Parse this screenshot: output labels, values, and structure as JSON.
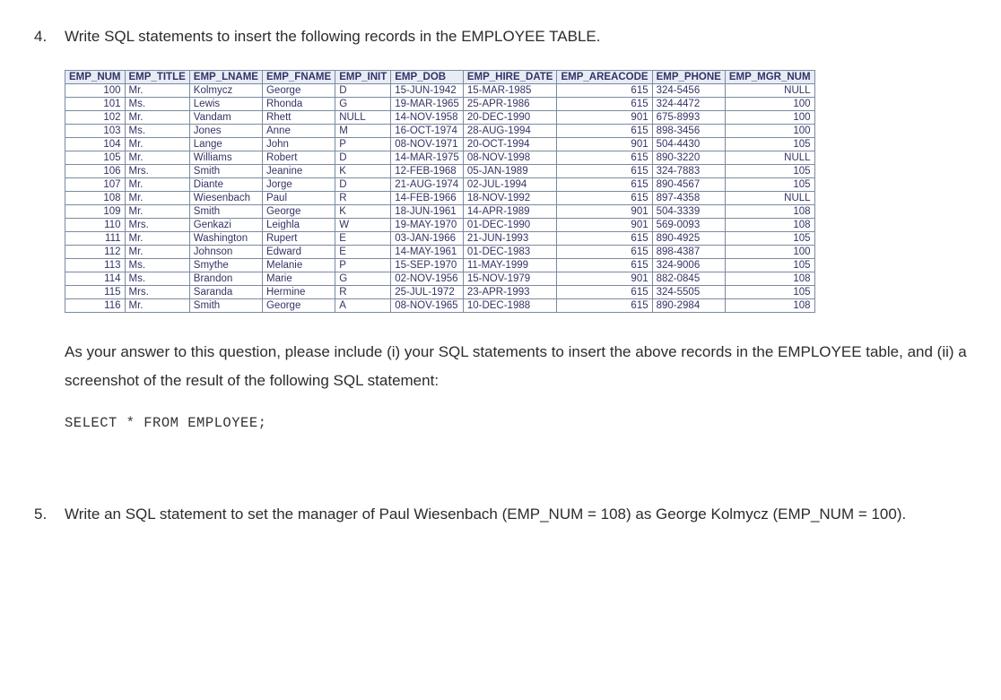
{
  "question4": {
    "number": "4.",
    "prompt": "Write SQL statements to insert the following records in the EMPLOYEE TABLE."
  },
  "employee_table": {
    "headers": [
      "EMP_NUM",
      "EMP_TITLE",
      "EMP_LNAME",
      "EMP_FNAME",
      "EMP_INIT",
      "EMP_DOB",
      "EMP_HIRE_DATE",
      "EMP_AREACODE",
      "EMP_PHONE",
      "EMP_MGR_NUM"
    ],
    "rows": [
      [
        "100",
        "Mr.",
        "Kolmycz",
        "George",
        "D",
        "15-JUN-1942",
        "15-MAR-1985",
        "615",
        "324-5456",
        "NULL"
      ],
      [
        "101",
        "Ms.",
        "Lewis",
        "Rhonda",
        "G",
        "19-MAR-1965",
        "25-APR-1986",
        "615",
        "324-4472",
        "100"
      ],
      [
        "102",
        "Mr.",
        "Vandam",
        "Rhett",
        "NULL",
        "14-NOV-1958",
        "20-DEC-1990",
        "901",
        "675-8993",
        "100"
      ],
      [
        "103",
        "Ms.",
        "Jones",
        "Anne",
        "M",
        "16-OCT-1974",
        "28-AUG-1994",
        "615",
        "898-3456",
        "100"
      ],
      [
        "104",
        "Mr.",
        "Lange",
        "John",
        "P",
        "08-NOV-1971",
        "20-OCT-1994",
        "901",
        "504-4430",
        "105"
      ],
      [
        "105",
        "Mr.",
        "Williams",
        "Robert",
        "D",
        "14-MAR-1975",
        "08-NOV-1998",
        "615",
        "890-3220",
        "NULL"
      ],
      [
        "106",
        "Mrs.",
        "Smith",
        "Jeanine",
        "K",
        "12-FEB-1968",
        "05-JAN-1989",
        "615",
        "324-7883",
        "105"
      ],
      [
        "107",
        "Mr.",
        "Diante",
        "Jorge",
        "D",
        "21-AUG-1974",
        "02-JUL-1994",
        "615",
        "890-4567",
        "105"
      ],
      [
        "108",
        "Mr.",
        "Wiesenbach",
        "Paul",
        "R",
        "14-FEB-1966",
        "18-NOV-1992",
        "615",
        "897-4358",
        "NULL"
      ],
      [
        "109",
        "Mr.",
        "Smith",
        "George",
        "K",
        "18-JUN-1961",
        "14-APR-1989",
        "901",
        "504-3339",
        "108"
      ],
      [
        "110",
        "Mrs.",
        "Genkazi",
        "Leighla",
        "W",
        "19-MAY-1970",
        "01-DEC-1990",
        "901",
        "569-0093",
        "108"
      ],
      [
        "111",
        "Mr.",
        "Washington",
        "Rupert",
        "E",
        "03-JAN-1966",
        "21-JUN-1993",
        "615",
        "890-4925",
        "105"
      ],
      [
        "112",
        "Mr.",
        "Johnson",
        "Edward",
        "E",
        "14-MAY-1961",
        "01-DEC-1983",
        "615",
        "898-4387",
        "100"
      ],
      [
        "113",
        "Ms.",
        "Smythe",
        "Melanie",
        "P",
        "15-SEP-1970",
        "11-MAY-1999",
        "615",
        "324-9006",
        "105"
      ],
      [
        "114",
        "Ms.",
        "Brandon",
        "Marie",
        "G",
        "02-NOV-1956",
        "15-NOV-1979",
        "901",
        "882-0845",
        "108"
      ],
      [
        "115",
        "Mrs.",
        "Saranda",
        "Hermine",
        "R",
        "25-JUL-1972",
        "23-APR-1993",
        "615",
        "324-5505",
        "105"
      ],
      [
        "116",
        "Mr.",
        "Smith",
        "George",
        "A",
        "08-NOV-1965",
        "10-DEC-1988",
        "615",
        "890-2984",
        "108"
      ]
    ],
    "col_align": [
      "num",
      "txt",
      "txt",
      "txt",
      "txt",
      "txt",
      "txt",
      "num",
      "txt",
      "num"
    ]
  },
  "answer_instructions": "As your answer to this question, please include (i) your SQL statements to insert the above records in the EMPLOYEE table, and (ii) a screenshot of the result of the following SQL statement:",
  "sql_statement": "SELECT * FROM EMPLOYEE;",
  "question5": {
    "number": "5.",
    "prompt": "Write an SQL statement to set the manager of Paul Wiesenbach (EMP_NUM = 108) as George Kolmycz (EMP_NUM = 100)."
  }
}
